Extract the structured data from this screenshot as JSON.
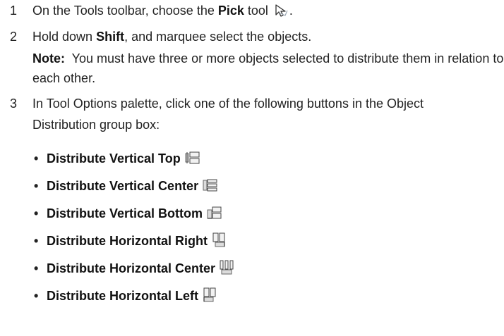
{
  "steps": [
    {
      "number": "1",
      "text_before": "On the Tools toolbar, choose the ",
      "bold": "Pick",
      "text_after": " tool",
      "trailing": ".",
      "icon": "pick-arrow-icon"
    },
    {
      "number": "2",
      "text_before": "Hold down ",
      "bold": "Shift",
      "text_after": ", and marquee select the objects.",
      "note_label": "Note:",
      "note_text": "  You must have three or more objects selected to distribute them in relation to each other."
    },
    {
      "number": "3",
      "text": "In Tool Options palette, click one of the following buttons in the Object Distribution group box:"
    }
  ],
  "bullet_glyph": "•",
  "buttons": [
    {
      "label": "Distribute Vertical Top",
      "icon": "distribute-vertical-top-icon"
    },
    {
      "label": "Distribute Vertical Center",
      "icon": "distribute-vertical-center-icon"
    },
    {
      "label": "Distribute Vertical Bottom",
      "icon": "distribute-vertical-bottom-icon"
    },
    {
      "label": "Distribute Horizontal Right",
      "icon": "distribute-horizontal-right-icon"
    },
    {
      "label": "Distribute Horizontal Center",
      "icon": "distribute-horizontal-center-icon"
    },
    {
      "label": "Distribute Horizontal Left",
      "icon": "distribute-horizontal-left-icon"
    }
  ]
}
